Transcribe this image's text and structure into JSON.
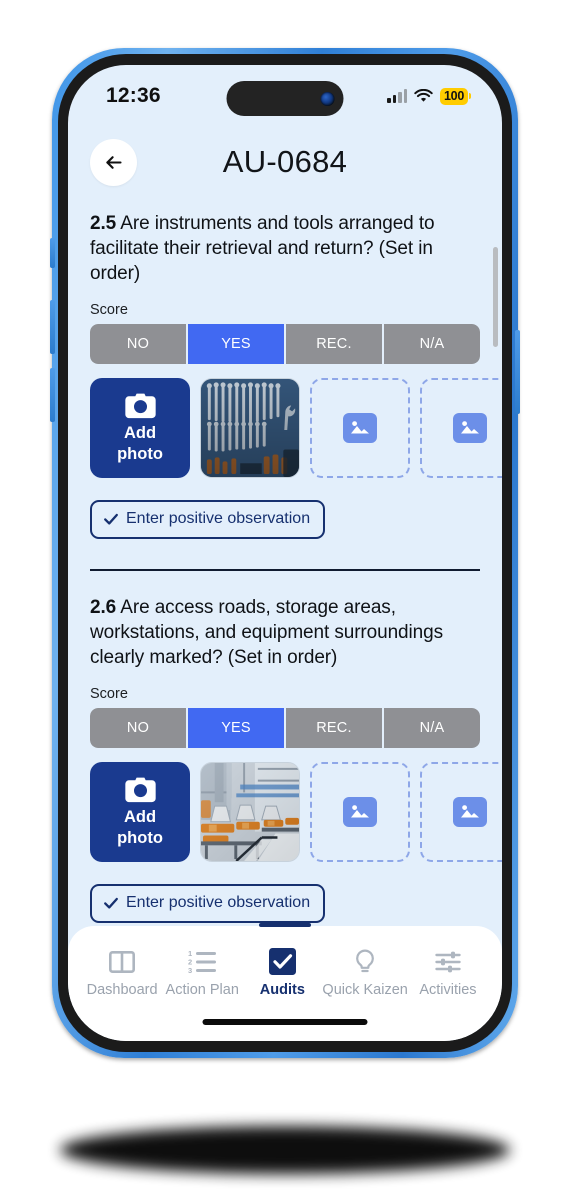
{
  "status_bar": {
    "time": "12:36",
    "battery_level": "100",
    "signal_icon": "cellular-signal-icon",
    "wifi_icon": "wifi-icon",
    "battery_color": "#ffcc00"
  },
  "header": {
    "back_icon": "back-arrow-icon",
    "title": "AU-0684"
  },
  "theme": {
    "screen_bg": "#e3effb",
    "accent_blue": "#4169f2",
    "dark_blue": "#16306f",
    "add_photo_bg": "#1a3a8f",
    "score_inactive": "#8f9094",
    "placeholder_border": "#8ea7e8"
  },
  "score_label": "Score",
  "score_options": [
    "NO",
    "YES",
    "REC.",
    "N/A"
  ],
  "add_photo": {
    "icon": "camera-icon",
    "line1": "Add",
    "line2": "photo"
  },
  "observation_button": {
    "icon": "check-icon",
    "label": "Enter positive observation"
  },
  "placeholder_icon": "image-placeholder-icon",
  "questions": [
    {
      "number": "2.5",
      "text": "Are instruments and tools arranged to facilitate their retrieval and return? (Set in order)",
      "selected_score": "YES",
      "photos": [
        {
          "name": "photo-thumbnail-wrenches-pegboard"
        },
        {
          "name": "photo-slot-empty"
        },
        {
          "name": "photo-slot-empty"
        }
      ]
    },
    {
      "number": "2.6",
      "text": "Are access roads, storage areas, workstations, and equipment surroundings clearly marked? (Set in order)",
      "selected_score": "YES",
      "photos": [
        {
          "name": "photo-thumbnail-factory-floor"
        },
        {
          "name": "photo-slot-empty"
        },
        {
          "name": "photo-slot-empty"
        }
      ]
    }
  ],
  "tabbar": {
    "active": "Audits",
    "items": [
      {
        "label": "Dashboard",
        "icon": "dashboard-icon"
      },
      {
        "label": "Action Plan",
        "icon": "numbered-list-icon"
      },
      {
        "label": "Audits",
        "icon": "checkbox-check-icon"
      },
      {
        "label": "Quick Kaizen",
        "icon": "lightbulb-icon"
      },
      {
        "label": "Activities",
        "icon": "sliders-icon"
      }
    ]
  }
}
